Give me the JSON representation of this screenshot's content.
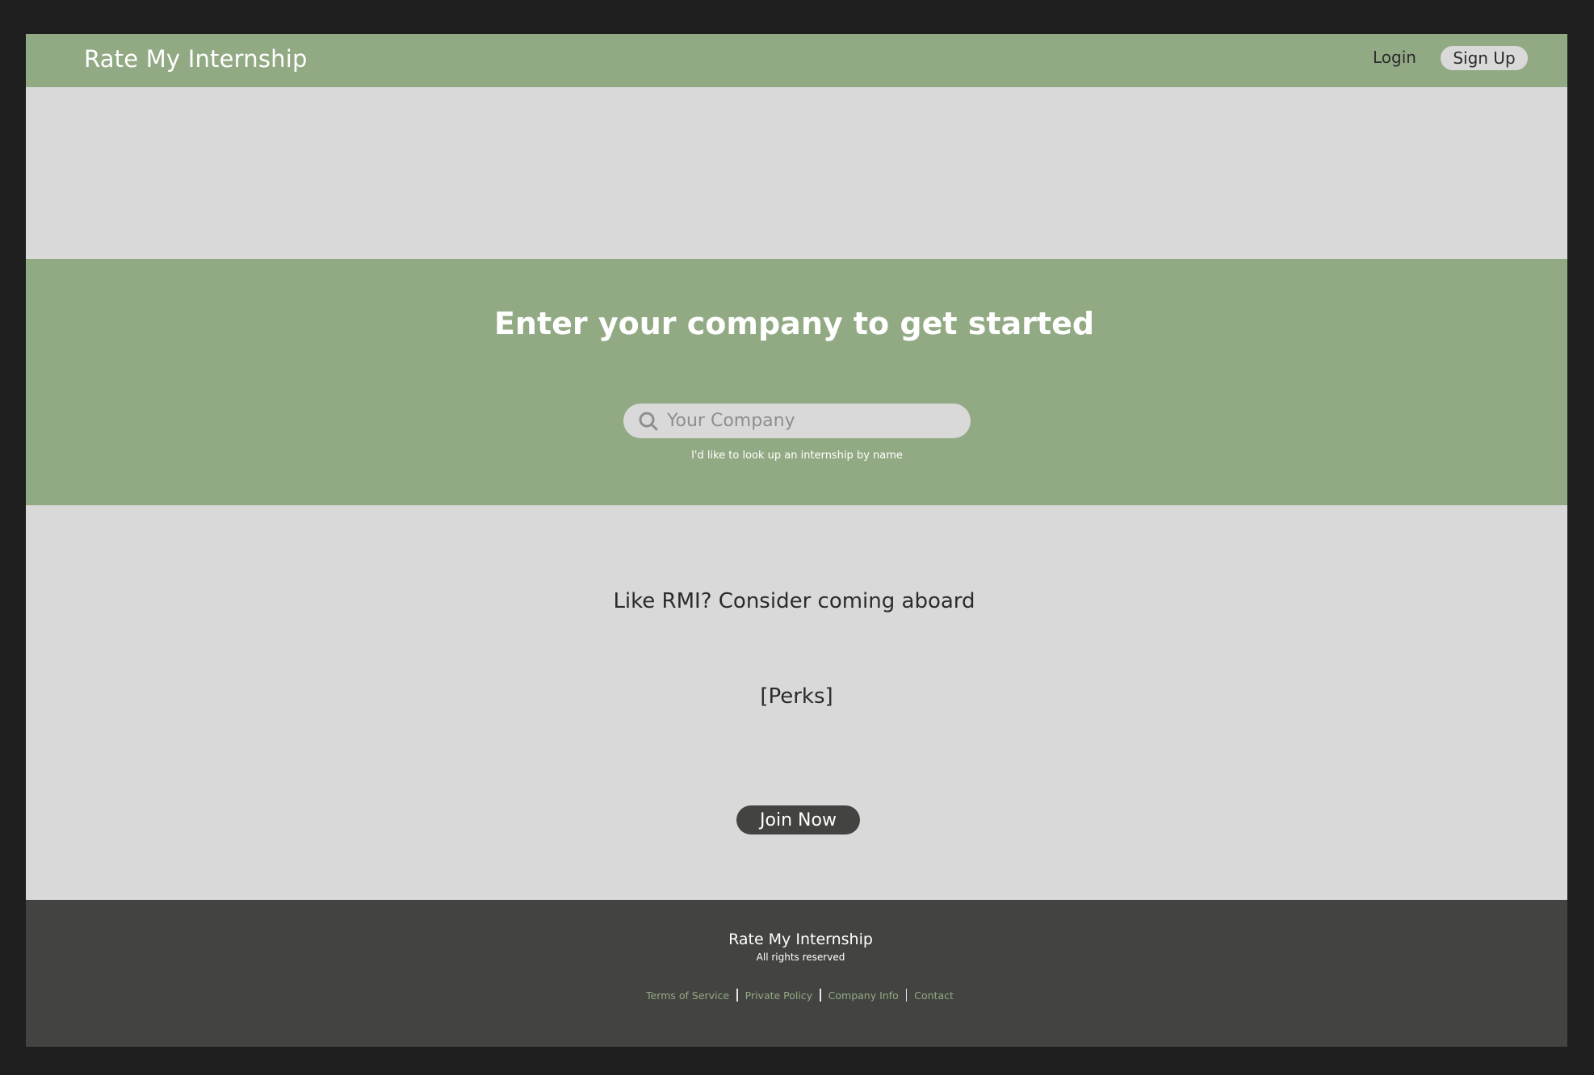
{
  "colors": {
    "page_background": "#1e1e1e",
    "canvas": "#d9d9d9",
    "accent_green": "#92aa84",
    "dark": "#434341",
    "text_dark": "#2b2b2b",
    "white": "#ffffff"
  },
  "header": {
    "brand": "Rate My Internship",
    "login_label": "Login",
    "signup_label": "Sign Up"
  },
  "hero": {
    "title": "Enter your company to get started",
    "search": {
      "icon": "search-icon",
      "placeholder": "Your Company",
      "value": ""
    },
    "hint": "I'd like to look up an internship by name"
  },
  "join": {
    "heading": "Like RMI? Consider coming aboard",
    "perks": "[Perks]",
    "button_label": "Join Now"
  },
  "footer": {
    "brand": "Rate My Internship",
    "rights": "All rights reserved",
    "links": [
      "Terms of Service",
      "Private Policy",
      "Company Info",
      "Contact"
    ]
  }
}
